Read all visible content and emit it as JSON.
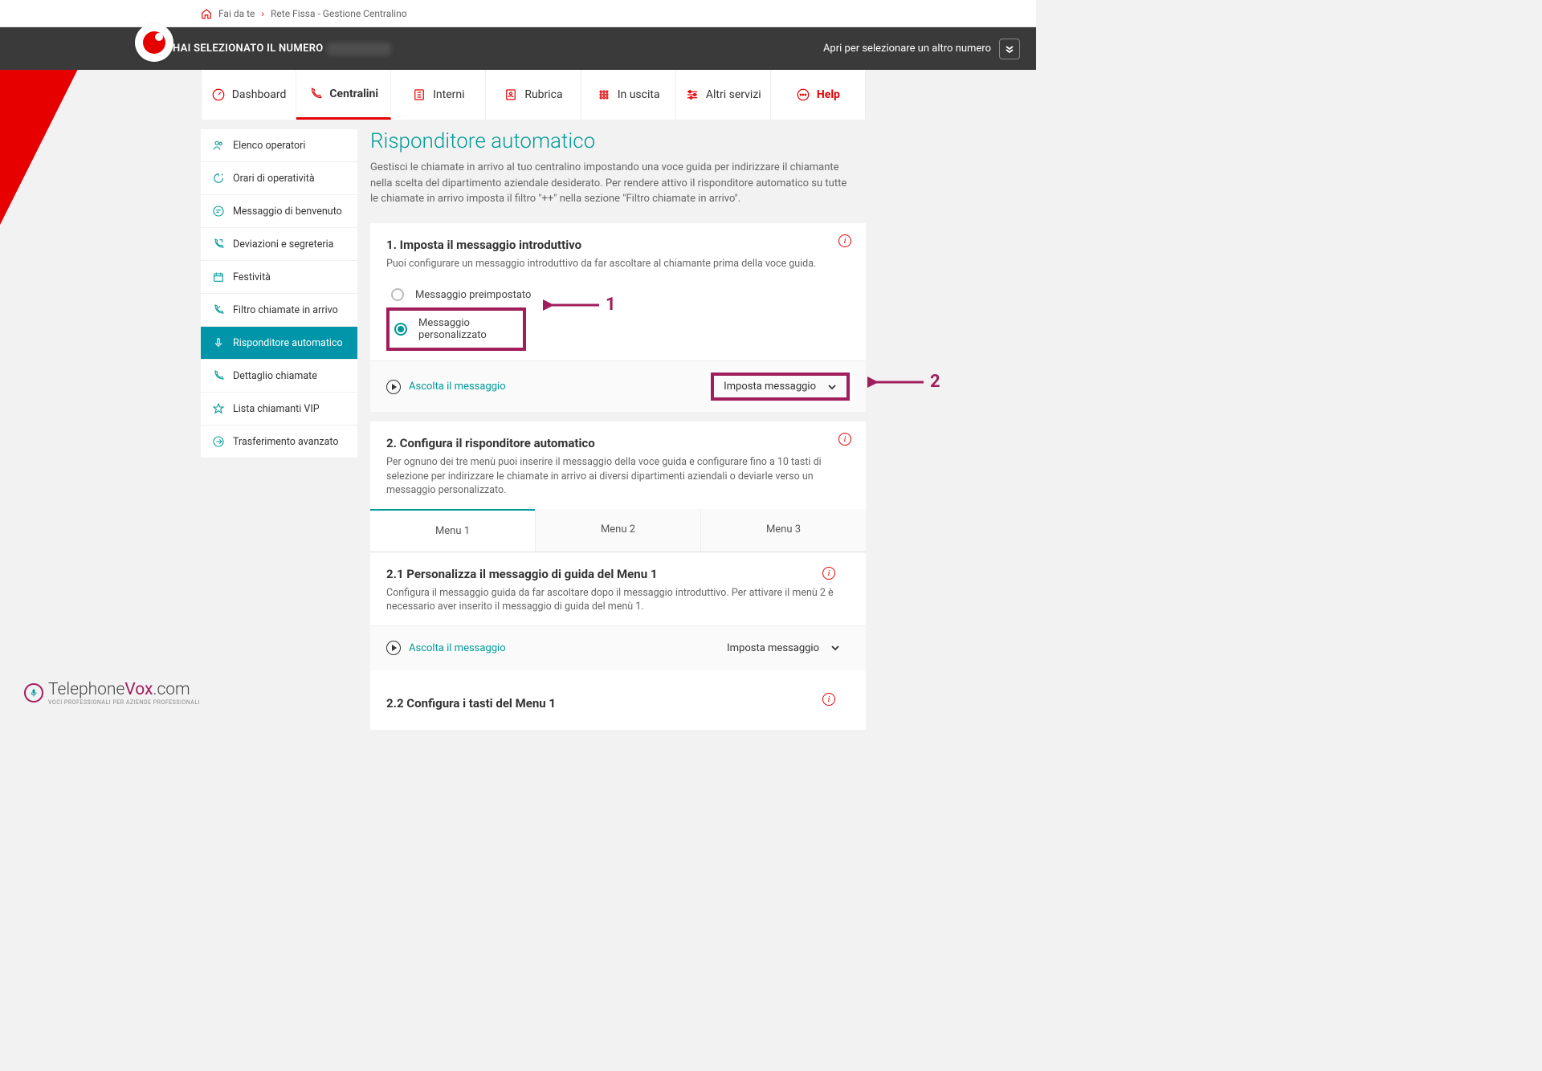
{
  "breadcrumb": {
    "home": "Fai da te",
    "page": "Rete Fissa - Gestione Centralino"
  },
  "darkbar": {
    "label": "HAI SELEZIONATO IL NUMERO",
    "right": "Apri per selezionare un altro numero"
  },
  "nav": {
    "dashboard": "Dashboard",
    "centralini": "Centralini",
    "interni": "Interni",
    "rubrica": "Rubrica",
    "uscita": "In uscita",
    "altri": "Altri servizi",
    "help": "Help"
  },
  "sidebar": [
    "Elenco operatori",
    "Orari di operatività",
    "Messaggio di benvenuto",
    "Deviazioni e segreteria",
    "Festività",
    "Filtro chiamate in arrivo",
    "Risponditore automatico",
    "Dettaglio chiamate",
    "Lista chiamanti VIP",
    "Trasferimento avanzato"
  ],
  "page": {
    "title": "Risponditore automatico",
    "desc": "Gestisci le chiamate in arrivo al tuo centralino impostando una voce guida per indirizzare il chiamante nella scelta del dipartimento aziendale desiderato. Per rendere attivo il risponditore automatico su tutte le chiamate in arrivo imposta il filtro \"++\" nella sezione \"Filtro chiamate in arrivo\"."
  },
  "step1": {
    "title": "1. Imposta il messaggio introduttivo",
    "sub": "Puoi configurare un messaggio introduttivo da far ascoltare al chiamante prima della voce guida.",
    "opt_pre": "Messaggio preimpostato",
    "opt_custom": "Messaggio personalizzato",
    "listen": "Ascolta il messaggio",
    "set": "Imposta messaggio"
  },
  "step2": {
    "title": "2. Configura il risponditore automatico",
    "sub": "Per ognuno dei tre menù puoi inserire il messaggio della voce guida e configurare fino a 10 tasti di selezione per indirizzare le chiamate in arrivo ai diversi dipartimenti aziendali o deviarle verso un messaggio personalizzato.",
    "tabs": [
      "Menu 1",
      "Menu 2",
      "Menu 3"
    ]
  },
  "step21": {
    "title": "2.1 Personalizza il messaggio di guida del Menu 1",
    "sub": "Configura il messaggio guida da far ascoltare dopo il messaggio introduttivo. Per attivare il menù 2 è necessario aver inserito il messaggio di guida del menù 1.",
    "listen": "Ascolta il messaggio",
    "set": "Imposta messaggio"
  },
  "step22": {
    "title": "2.2 Configura i tasti del Menu 1"
  },
  "annotations": {
    "one": "1",
    "two": "2"
  },
  "watermark": {
    "brand": "Telephone",
    "brand2": "Vox",
    "suffix": ".com",
    "tagline": "VOCI PROFESSIONALI PER AZIENDE PROFESSIONALI"
  }
}
